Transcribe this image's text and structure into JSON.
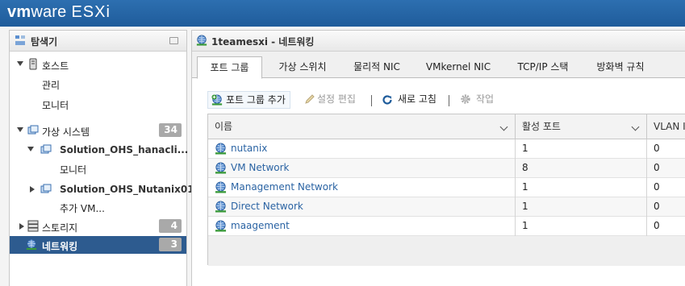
{
  "brand": {
    "vm": "vm",
    "ware": "ware",
    "esxi": "ESXi"
  },
  "navigator": {
    "title": "탐색기",
    "host": "호스트",
    "host_children": [
      "관리",
      "모니터"
    ],
    "vms": {
      "label": "가상 시스템",
      "count": "34"
    },
    "vm1": {
      "label": "Solution_OHS_hanacli...",
      "child": "모니터"
    },
    "vm2": {
      "label": "Solution_OHS_Nutanix01",
      "child": "추가 VM..."
    },
    "storage": {
      "label": "스토리지",
      "count": "4"
    },
    "networking": {
      "label": "네트워킹",
      "count": "3"
    }
  },
  "main": {
    "title": "1teamesxi - 네트워킹",
    "tabs": [
      "포트 그룹",
      "가상 스위치",
      "물리적 NIC",
      "VMkernel NIC",
      "TCP/IP 스택",
      "방화벽 규칙"
    ],
    "active_tab": "포트 그룹",
    "toolbar": {
      "add": "포트 그룹 추가",
      "edit": "설정 편집",
      "refresh": "새로 고침",
      "actions": "작업"
    },
    "table": {
      "columns": [
        "이름",
        "활성 포트",
        "VLAN ID"
      ],
      "rows": [
        {
          "name": "nutanix",
          "ports": "1",
          "vlan": "0"
        },
        {
          "name": "VM Network",
          "ports": "8",
          "vlan": "0"
        },
        {
          "name": "Management Network",
          "ports": "1",
          "vlan": "0"
        },
        {
          "name": "Direct Network",
          "ports": "1",
          "vlan": "0"
        },
        {
          "name": "maagement",
          "ports": "1",
          "vlan": "0"
        }
      ]
    }
  },
  "colors": {
    "header": "#1f5c9b",
    "selected": "#2d5b8f",
    "link": "#2a63a3",
    "badge": "#a9a9a9"
  }
}
